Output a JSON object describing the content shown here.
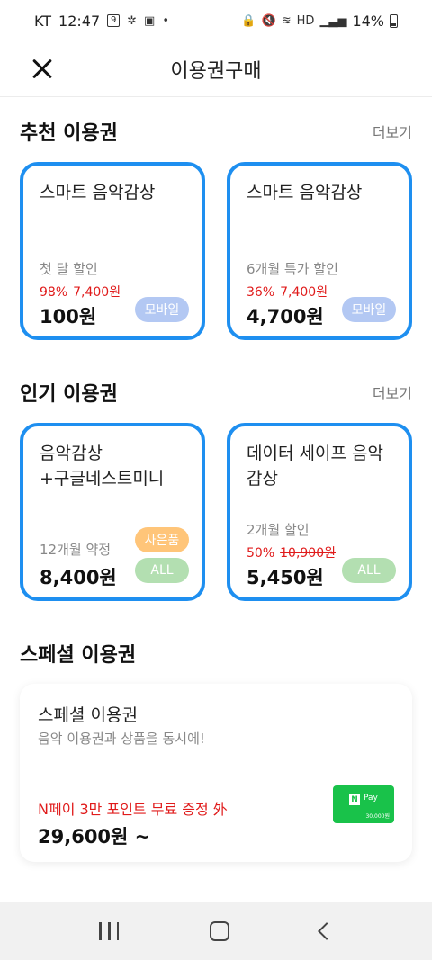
{
  "status_bar": {
    "carrier": "KT",
    "time": "12:47",
    "battery": "14%"
  },
  "header": {
    "title": "이용권구매"
  },
  "recommended": {
    "title": "추천 이용권",
    "more": "더보기",
    "cards": [
      {
        "name": "스마트 음악감상",
        "sub": "첫 달 할인",
        "discount_rate": "98%",
        "original_price": "7,400원",
        "price": "100원",
        "badge": "모바일"
      },
      {
        "name": "스마트 음악감상",
        "sub": "6개월 특가 할인",
        "discount_rate": "36%",
        "original_price": "7,400원",
        "price": "4,700원",
        "badge": "모바일"
      }
    ]
  },
  "popular": {
    "title": "인기 이용권",
    "more": "더보기",
    "cards": [
      {
        "name": "음악감상\n+구글네스트미니",
        "sub": "12개월 약정",
        "price": "8,400원",
        "badge_gift": "사은품",
        "badge": "ALL"
      },
      {
        "name": "데이터 세이프 음악\n감상",
        "sub": "2개월 할인",
        "discount_rate": "50%",
        "original_price": "10,900원",
        "price": "5,450원",
        "badge": "ALL"
      }
    ]
  },
  "special": {
    "section_title": "스페셜 이용권",
    "card_title": "스페셜 이용권",
    "description": "음악 이용권과 상품을 동시에!",
    "promo": "N페이 3만 포인트 무료 증정 外",
    "price": "29,600원 ~",
    "npay_label": "Pay",
    "npay_amount": "30,000원"
  },
  "colors": {
    "accent": "#1e8ff0",
    "discount": "#e01b1b",
    "badge_mobile": "#b3c8f3",
    "badge_gift": "#ffc579",
    "badge_all": "#b3dfb1",
    "npay": "#19c24a"
  }
}
